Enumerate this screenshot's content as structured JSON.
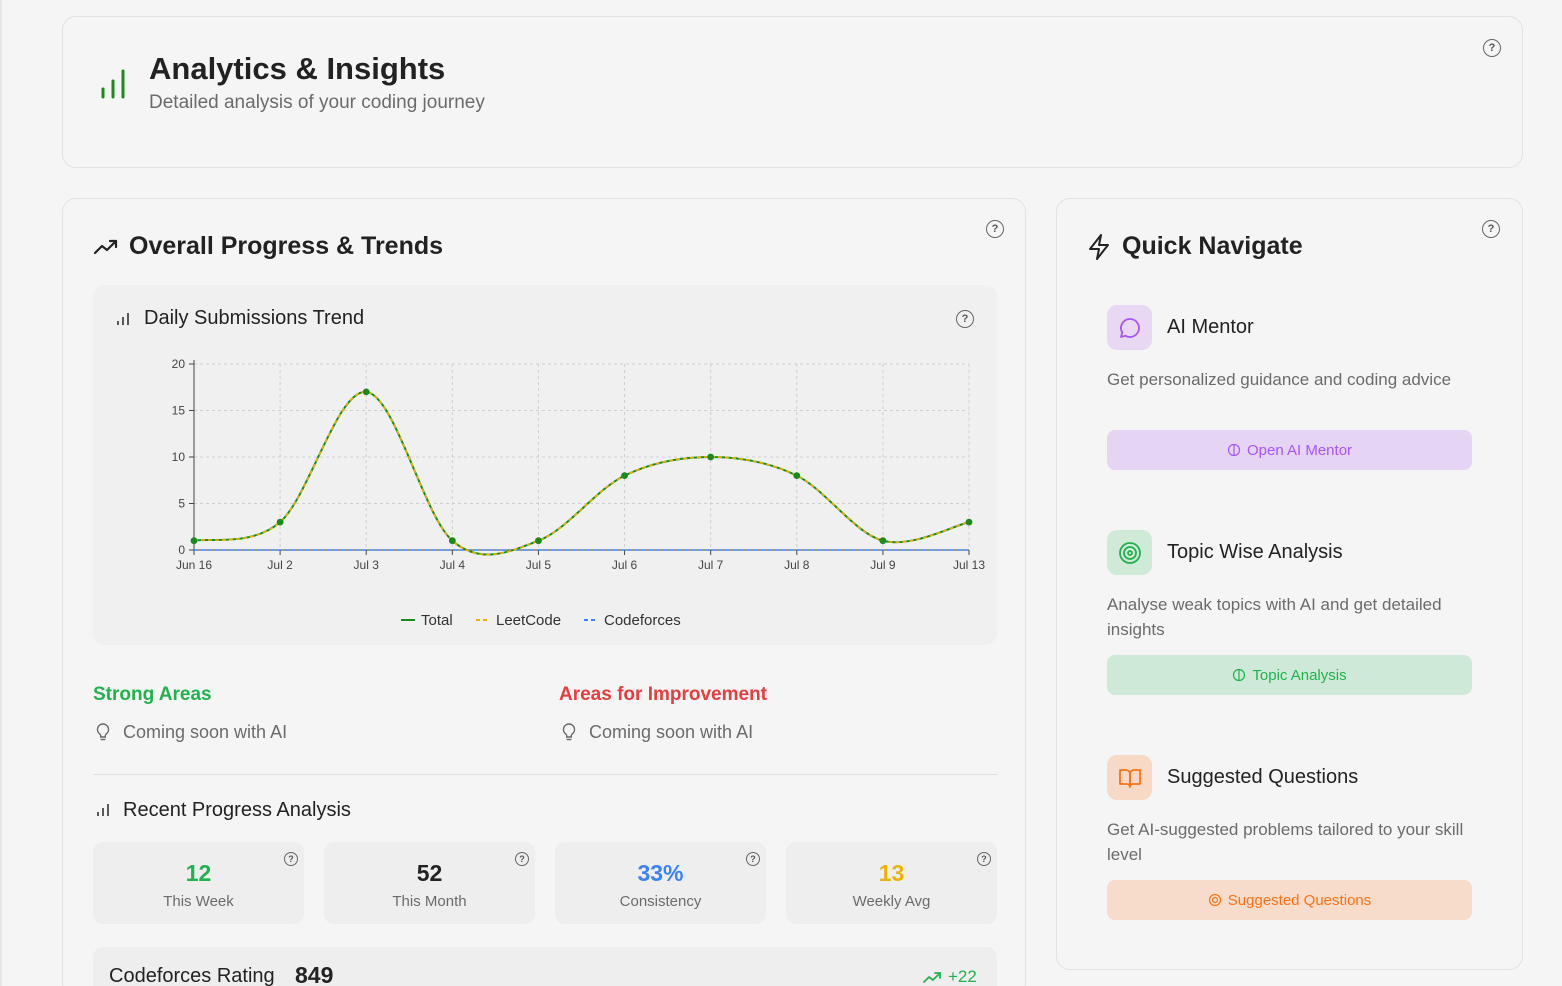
{
  "header": {
    "title": "Analytics & Insights",
    "subtitle": "Detailed analysis of your coding journey"
  },
  "progress": {
    "title": "Overall Progress & Trends",
    "chart_title": "Daily Submissions Trend",
    "strong": {
      "title": "Strong Areas",
      "text": "Coming soon with AI"
    },
    "improve": {
      "title": "Areas for Improvement",
      "text": "Coming soon with AI"
    },
    "recent_title": "Recent Progress Analysis",
    "stats": [
      {
        "value": "12",
        "label": "This Week",
        "color": "#22b14c"
      },
      {
        "value": "52",
        "label": "This Month",
        "color": "#222222"
      },
      {
        "value": "33%",
        "label": "Consistency",
        "color": "#3b82f6"
      },
      {
        "value": "13",
        "label": "Weekly Avg",
        "color": "#eab308"
      }
    ],
    "rating": {
      "label": "Codeforces Rating",
      "value": "849",
      "change": "+22"
    }
  },
  "chart_data": {
    "type": "line",
    "categories": [
      "Jun 16",
      "Jul 2",
      "Jul 3",
      "Jul 4",
      "Jul 5",
      "Jul 6",
      "Jul 7",
      "Jul 8",
      "Jul 9",
      "Jul 13"
    ],
    "series": [
      {
        "name": "Total",
        "values": [
          1,
          3,
          17,
          1,
          1,
          8,
          10,
          8,
          1,
          3
        ],
        "color": "#1a8a1a"
      },
      {
        "name": "LeetCode",
        "values": [
          1,
          3,
          17,
          1,
          1,
          8,
          10,
          8,
          1,
          3
        ],
        "color": "#eab308"
      },
      {
        "name": "Codeforces",
        "values": [
          0,
          0,
          0,
          0,
          0,
          0,
          0,
          0,
          0,
          0
        ],
        "color": "#3b82f6"
      }
    ],
    "ylim": [
      0,
      20
    ],
    "yticks": [
      0,
      5,
      10,
      15,
      20
    ],
    "grid": true,
    "legend": "bottom-center"
  },
  "nav": {
    "title": "Quick Navigate",
    "items": [
      {
        "title": "AI Mentor",
        "desc": "Get personalized guidance and coding advice",
        "button": "Open AI Mentor",
        "icon": "message-circle-icon",
        "color": "#a855f7",
        "bg": "#e8d8f4",
        "btnbg": "#e5d4f3"
      },
      {
        "title": "Topic Wise Analysis",
        "desc": "Analyse weak topics with AI and get detailed insights",
        "button": "Topic Analysis",
        "icon": "target-icon",
        "color": "#22b14c",
        "bg": "#cfebd8",
        "btnbg": "#cfe9d9"
      },
      {
        "title": "Suggested Questions",
        "desc": "Get AI-suggested problems tailored to your skill level",
        "button": "Suggested Questions",
        "icon": "book-open-icon",
        "color": "#f97316",
        "bg": "#f8d9c6",
        "btnbg": "#f7dccb"
      }
    ]
  }
}
